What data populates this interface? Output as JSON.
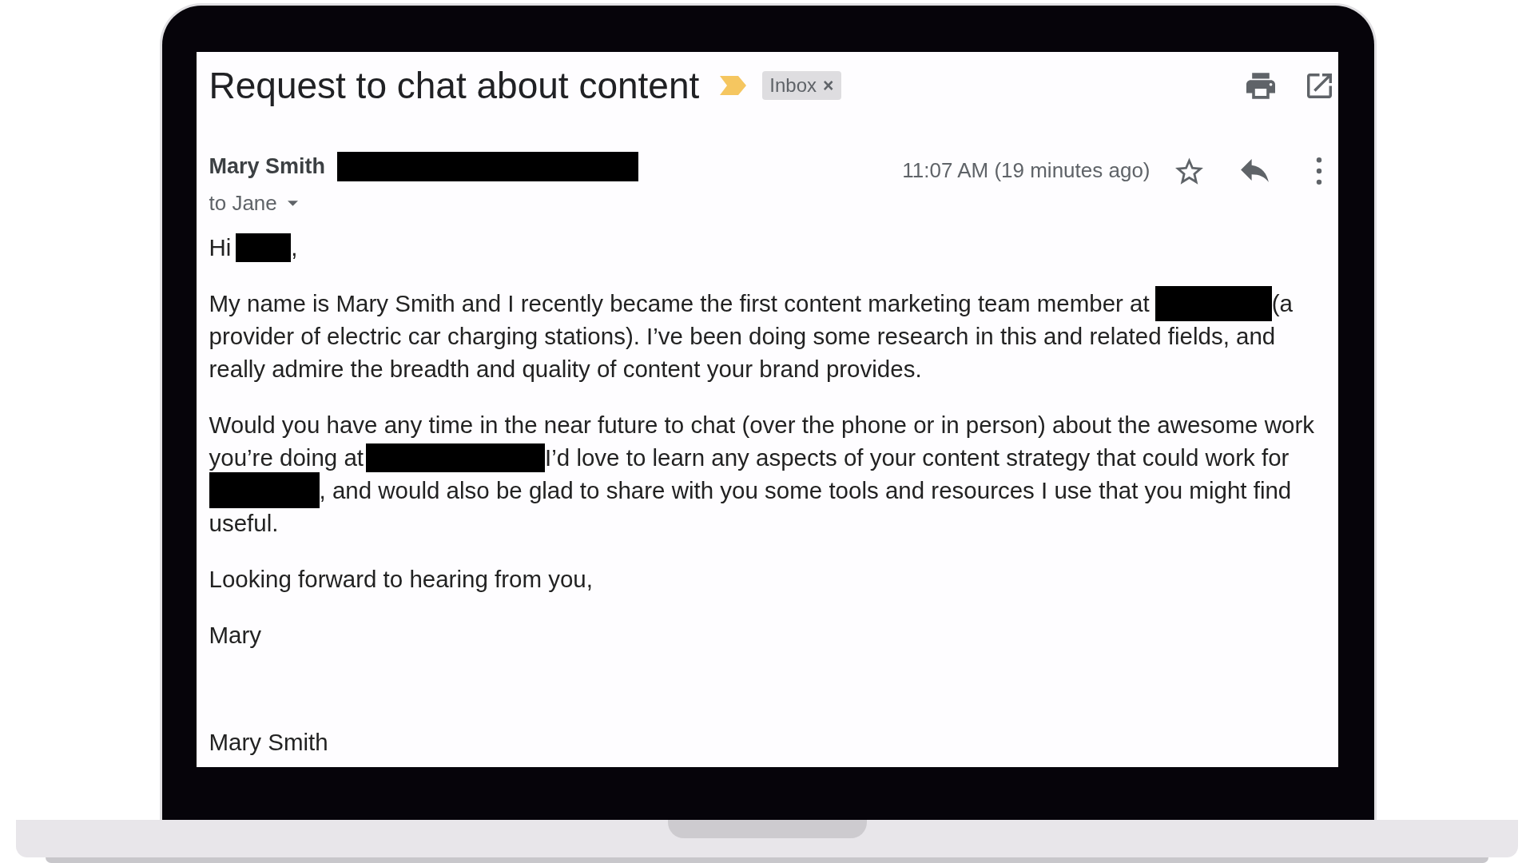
{
  "email": {
    "subject": "Request to chat about content",
    "important": true,
    "labels": [
      {
        "text": "Inbox",
        "remove": "×"
      }
    ],
    "sender": {
      "name": "Mary Smith",
      "address_redacted": true
    },
    "recipient": "to Jane",
    "time": "11:07 AM (19 minutes ago)",
    "starred": false,
    "body": [
      {
        "kind": "paragraph",
        "lines": [
          {
            "parts": [
              {
                "kind": "text",
                "text": "Hi"
              },
              {
                "kind": "redacted"
              },
              {
                "kind": "text",
                "text": ","
              }
            ]
          }
        ]
      },
      {
        "kind": "paragraph",
        "lines": [
          {
            "parts": [
              {
                "kind": "text",
                "text": "My name is Mary Smith and I recently became the first content marketing team member at"
              },
              {
                "kind": "redacted"
              },
              {
                "kind": "text",
                "text": "(a"
              }
            ]
          },
          {
            "parts": [
              {
                "kind": "text",
                "text": "provider of electric car charging stations). I’ve been doing some research in this and related fields, and"
              }
            ]
          },
          {
            "parts": [
              {
                "kind": "text",
                "text": "really admire the breadth and quality of content your brand provides."
              }
            ]
          }
        ]
      },
      {
        "kind": "paragraph",
        "lines": [
          {
            "parts": [
              {
                "kind": "text",
                "text": "Would you have any time in the near future to chat (over the phone or in person) about the awesome work"
              }
            ]
          },
          {
            "parts": [
              {
                "kind": "text",
                "text": "you’re doing at"
              },
              {
                "kind": "redacted"
              },
              {
                "kind": "text",
                "text": "I’d love to learn any aspects of your content strategy that could work for"
              }
            ]
          },
          {
            "parts": [
              {
                "kind": "redacted"
              },
              {
                "kind": "text",
                "text": ", and would also be glad to share with you some tools and resources I use that you might find"
              }
            ]
          },
          {
            "parts": [
              {
                "kind": "text",
                "text": "useful."
              }
            ]
          }
        ]
      },
      {
        "kind": "paragraph",
        "lines": [
          {
            "parts": [
              {
                "kind": "text",
                "text": "Looking forward to hearing from you,"
              }
            ]
          }
        ]
      },
      {
        "kind": "paragraph",
        "lines": [
          {
            "parts": [
              {
                "kind": "text",
                "text": "Mary"
              }
            ]
          }
        ]
      },
      {
        "kind": "signature",
        "lines": [
          {
            "parts": [
              {
                "kind": "text",
                "text": "Mary Smith"
              }
            ]
          }
        ]
      }
    ]
  }
}
